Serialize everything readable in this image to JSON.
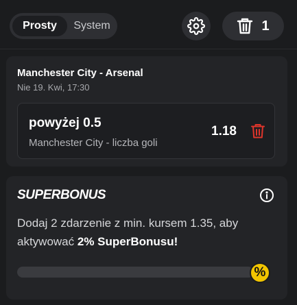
{
  "header": {
    "mode_options": [
      "Prosty",
      "System"
    ],
    "active_mode": "Prosty",
    "settings_icon": "gear-icon",
    "trash_icon": "trash-icon",
    "slip_count": "1"
  },
  "bet": {
    "match": "Manchester City  -  Arsenal",
    "date": "Nie 19. Kwi, 17:30",
    "selection": "powyżej 0.5",
    "market": "Manchester City - liczba goli",
    "odds": "1.18",
    "remove_icon": "trash-icon",
    "remove_color": "#e0352b"
  },
  "superbonus": {
    "title": "SUPERBONUS",
    "info_icon": "info-icon",
    "text_prefix": "Dodaj 2 zdarzenie z min. kursem 1.35, aby aktywować ",
    "text_bold": "2% SuperBonusu!",
    "progress": 0,
    "badge": "%",
    "accent": "#f2c500"
  }
}
